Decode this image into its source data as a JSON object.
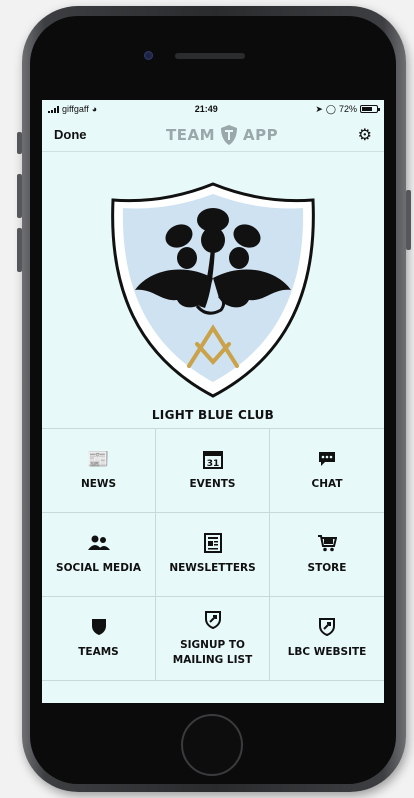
{
  "status_bar": {
    "carrier": "giffgaff",
    "time": "21:49",
    "battery": "72%",
    "battery_level": 0.72
  },
  "nav": {
    "done_label": "Done",
    "brand_left": "TEAM",
    "brand_right": "APP"
  },
  "club": {
    "name": "LIGHT BLUE CLUB"
  },
  "tiles": [
    {
      "label": "NEWS",
      "icon": "newspaper-icon"
    },
    {
      "label": "EVENTS",
      "icon": "calendar-icon",
      "icon_text": "31"
    },
    {
      "label": "CHAT",
      "icon": "chat-icon"
    },
    {
      "label": "SOCIAL MEDIA",
      "icon": "people-icon"
    },
    {
      "label": "NEWSLETTERS",
      "icon": "newsletter-icon"
    },
    {
      "label": "STORE",
      "icon": "cart-icon"
    },
    {
      "label": "TEAMS",
      "icon": "shield-icon"
    },
    {
      "label": "SIGNUP TO\nMAILING LIST",
      "icon": "shield-link-icon"
    },
    {
      "label": "LBC WEBSITE",
      "icon": "shield-link-icon"
    }
  ],
  "colors": {
    "screen_bg": "#e7f9f8",
    "shield_fill": "#cfe2f2",
    "gold": "#c9a24a"
  }
}
